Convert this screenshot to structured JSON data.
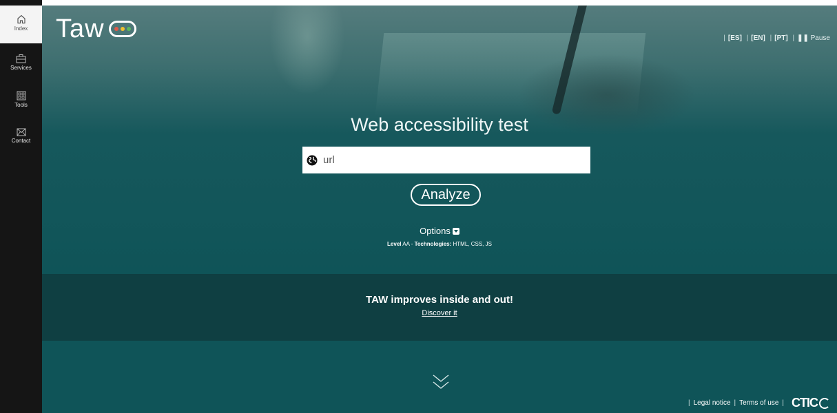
{
  "sidebar": {
    "items": [
      {
        "label": "Index",
        "icon": "home-icon"
      },
      {
        "label": "Services",
        "icon": "briefcase-icon"
      },
      {
        "label": "Tools",
        "icon": "grid-icon"
      },
      {
        "label": "Contact",
        "icon": "mail-icon"
      }
    ]
  },
  "header": {
    "logo_text": "Taw",
    "languages": [
      "[ES]",
      "[EN]",
      "[PT]"
    ],
    "pause_label": "Pause"
  },
  "main": {
    "title": "Web accessibility test",
    "url_placeholder": "url",
    "analyze_label": "Analyze",
    "options_label": "Options",
    "level_label": "Level",
    "level_value": "AA",
    "technologies_label": "Technologies",
    "technologies_value": "HTML, CSS, JS"
  },
  "banner": {
    "heading": "TAW improves inside and out!",
    "link": "Discover it"
  },
  "footer": {
    "legal": "Legal notice",
    "terms": "Terms of use",
    "brand": "CTIC"
  },
  "colors": {
    "hero_teal": "#16585c",
    "banner_dark": "#0f3f42",
    "sidebar": "#151515",
    "light_red": "#e05a4a",
    "light_yellow": "#f0c030",
    "light_green": "#5cb85c"
  }
}
